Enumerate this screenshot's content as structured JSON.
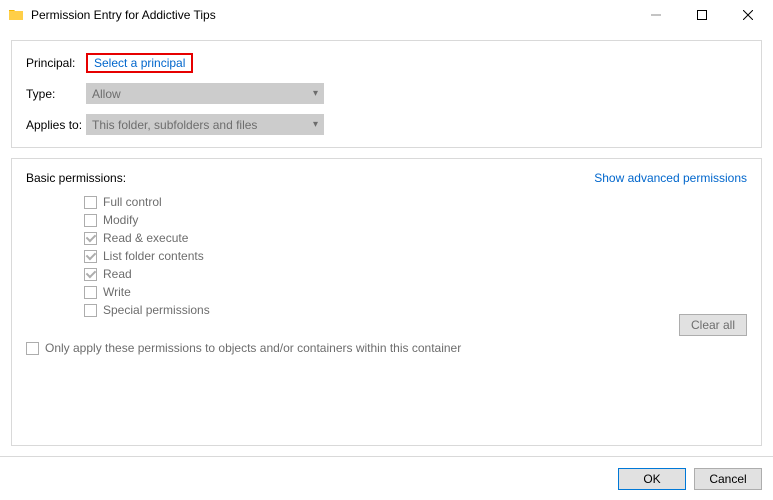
{
  "window": {
    "title": "Permission Entry for Addictive Tips"
  },
  "header": {
    "principal_label": "Principal:",
    "select_principal": "Select a principal",
    "type_label": "Type:",
    "type_value": "Allow",
    "applies_label": "Applies to:",
    "applies_value": "This folder, subfolders and files"
  },
  "permissions": {
    "title": "Basic permissions:",
    "advanced_link": "Show advanced permissions",
    "items": [
      {
        "label": "Full control",
        "checked": false
      },
      {
        "label": "Modify",
        "checked": false
      },
      {
        "label": "Read & execute",
        "checked": true
      },
      {
        "label": "List folder contents",
        "checked": true
      },
      {
        "label": "Read",
        "checked": true
      },
      {
        "label": "Write",
        "checked": false
      },
      {
        "label": "Special permissions",
        "checked": false
      }
    ],
    "only_apply": "Only apply these permissions to objects and/or containers within this container",
    "clear_all": "Clear all"
  },
  "footer": {
    "ok": "OK",
    "cancel": "Cancel"
  }
}
